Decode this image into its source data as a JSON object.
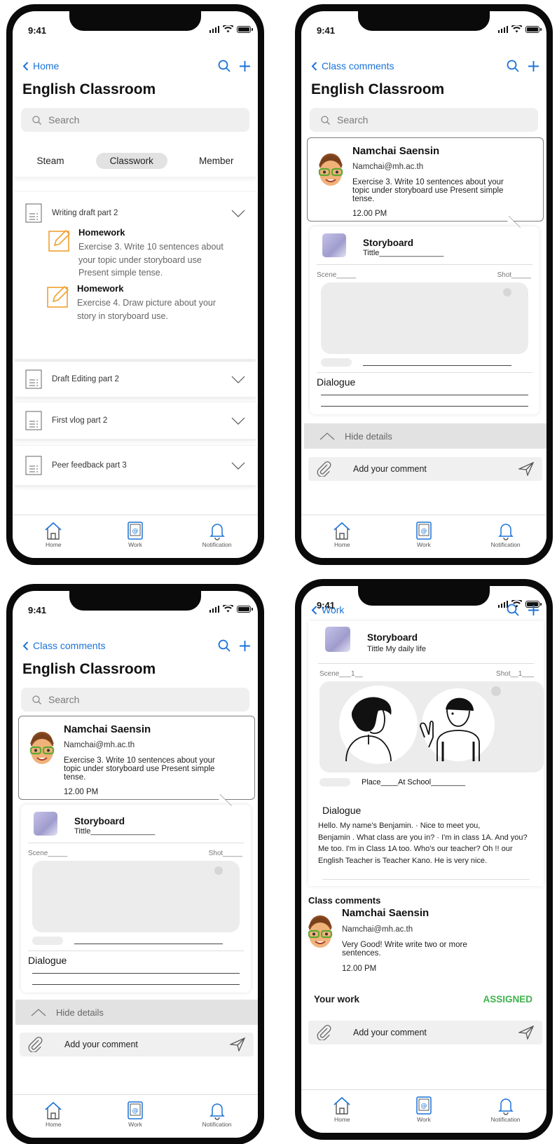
{
  "status": {
    "time": "9:41"
  },
  "app": {
    "title": "English Classroom",
    "search_placeholder": "Search"
  },
  "tabbar": {
    "home": "Home",
    "work": "Work",
    "notification": "Notification"
  },
  "screen1": {
    "back_label": "Home",
    "tabs": [
      "Steam",
      "Classwork",
      "Member"
    ],
    "active_tab": "Classwork",
    "topics": [
      {
        "title": "Writing draft  part  2",
        "expanded": true
      },
      {
        "title": "Draft Editing part 2"
      },
      {
        "title": "First vlog part 2"
      },
      {
        "title": "Peer feedback part 3"
      }
    ],
    "homework": [
      {
        "title": "Homework",
        "text_lines": [
          "Exercise 3. Write 10 sentences about",
          "your topic under storyboard use",
          "Present simple tense."
        ]
      },
      {
        "title": "Homework",
        "text_lines": [
          "Exercise 4. Draw picture about your",
          "story in storyboard use."
        ]
      }
    ]
  },
  "comment": {
    "back_label": "Class comments",
    "name": "Namchai Saensin",
    "email": "Namchai@mh.ac.th",
    "text_lines": [
      "Exercise 3. Write 10 sentences about your",
      "topic under storyboard use Present simple",
      "tense."
    ],
    "time": "12.00 PM"
  },
  "storyboard": {
    "title": "Storyboard",
    "tittle_blank": "Tittle_______________",
    "scene_blank": "Scene_____",
    "shot_blank": "Shot_____",
    "dialogue": "Dialogue",
    "hide_details": "Hide details",
    "add_comment": "Add your comment"
  },
  "screen4": {
    "back_label": "Work",
    "storyboard_title": "Storyboard",
    "tittle": "Tittle  My daily life",
    "scene": "Scene___1__",
    "shot": "Shot__1___",
    "place": "Place____At School________",
    "dialogue": "Dialogue",
    "story_lines": [
      "        Hello. My name's Benjamin. · Nice to meet you,",
      "Benjamin . What class are you in? · I'm in class 1A. And you?",
      "Me too. I'm in Class 1A too.  Who's our teacher? Oh !! our",
      "English Teacher is Teacher Kano. He is very nice."
    ],
    "class_comments": "Class comments",
    "comment_name": "Namchai Saensin",
    "comment_email": "Namchai@mh.ac.th",
    "comment_lines": [
      "Very Good! Write write two or more",
      "sentences."
    ],
    "comment_time": "12.00 PM",
    "your_work": "Your work",
    "work_status": "ASSIGNED",
    "add_comment": "Add your comment"
  },
  "colors": {
    "accent": "#1a73d9",
    "assigned": "#3cb44b",
    "homework_icon": "#f0a030"
  }
}
